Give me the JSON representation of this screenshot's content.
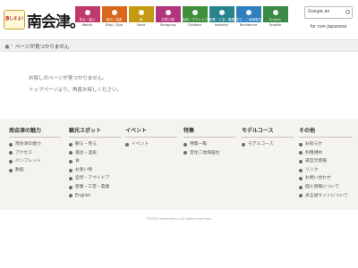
{
  "header": {
    "logo_badge": "旅しそよ!",
    "logo_text": "南会津。",
    "nav": [
      {
        "jp": "見る・遊ぶ",
        "en": "Watch",
        "color": "#c0396b"
      },
      {
        "jp": "宿泊・温泉",
        "en": "Stay / Spa",
        "color": "#d9671d"
      },
      {
        "jp": "食",
        "en": "Food",
        "color": "#c49a12"
      },
      {
        "jp": "お買い物",
        "en": "Shopping",
        "color": "#b4357f"
      },
      {
        "jp": "自然・アウトドア",
        "en": "Outdoor",
        "color": "#3f8f3a"
      },
      {
        "jp": "産業・工芸・農業",
        "en": "Industry",
        "color": "#28848c"
      },
      {
        "jp": "住む・二地域居住",
        "en": "Residence",
        "color": "#2f7fbf"
      },
      {
        "jp": "English",
        "en": "English",
        "color": "#3a8a44"
      }
    ],
    "search_placeholder": "Google an",
    "foreign_button": "for non-Japanese"
  },
  "breadcrumb": {
    "current": "ページが見つかりません"
  },
  "message": {
    "line1": "お探しのページが見つかりません。",
    "line2": "トップページより、再度お探しください。"
  },
  "sitemap": {
    "columns": [
      {
        "heading": "南会津の魅力",
        "items": [
          "南会津の魅力",
          "アクセス",
          "パンフレット",
          "動画"
        ]
      },
      {
        "heading": "観光スポット",
        "items": [
          "観る・見る",
          "宿泊・温泉",
          "食",
          "お買い物",
          "自然・アウトドア",
          "産業・工芸・農業",
          "English"
        ]
      },
      {
        "heading": "イベント",
        "items": [
          "イベント"
        ]
      },
      {
        "heading": "特集",
        "items": [
          "特集一覧",
          "定住二地域居住"
        ]
      },
      {
        "heading": "モデルコース",
        "items": [
          "モデルコース"
        ]
      },
      {
        "heading": "その他",
        "items": [
          "お知らせ",
          "利用規約",
          "運営元情報",
          "リンク",
          "お問い合わせ",
          "個人情報について",
          "多言語サイトについて"
        ]
      }
    ]
  },
  "footer": {
    "copyright": "©2020 minamiaizu All rights reserved."
  }
}
